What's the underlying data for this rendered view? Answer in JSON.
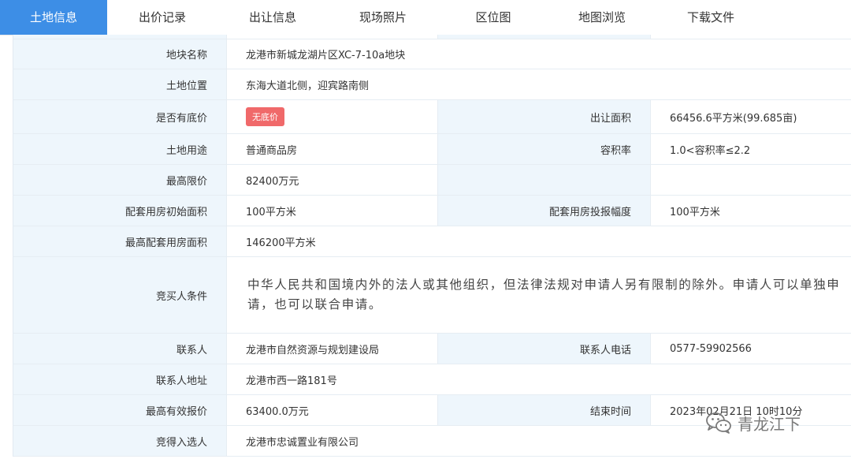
{
  "tabs": [
    "土地信息",
    "出价记录",
    "出让信息",
    "现场照片",
    "区位图",
    "地图浏览",
    "下载文件"
  ],
  "rows": {
    "name": {
      "label": "地块名称",
      "value": "龙港市新城龙湖片区XC-7-10a地块"
    },
    "location": {
      "label": "土地位置",
      "value": "东海大道北侧，迎宾路南侧"
    },
    "reserve": {
      "label": "是否有底价",
      "badge": "无底价",
      "label2": "出让面积",
      "value2": "66456.6平方米(99.685亩)"
    },
    "use": {
      "label": "土地用途",
      "value": "普通商品房",
      "label2": "容积率",
      "value2": "1.0<容积率≤2.2"
    },
    "max_price": {
      "label": "最高限价",
      "value": "82400万元"
    },
    "housing_init": {
      "label": "配套用房初始面积",
      "value": "100平方米",
      "label2": "配套用房投报幅度",
      "value2": "100平方米"
    },
    "housing_max": {
      "label": "最高配套用房面积",
      "value": "146200平方米"
    },
    "conditions": {
      "label": "竞买人条件",
      "value": "中华人民共和国境内外的法人或其他组织，但法律法规对申请人另有限制的除外。申请人可以单独申请，也可以联合申请。"
    },
    "contact": {
      "label": "联系人",
      "value": "龙港市自然资源与规划建设局",
      "label2": "联系人电话",
      "value2": "0577-59902566"
    },
    "address": {
      "label": "联系人地址",
      "value": "龙港市西一路181号"
    },
    "top_bid": {
      "label": "最高有效报价",
      "value": "63400.0万元",
      "label2": "结束时间",
      "value2": "2023年02月21日 10时10分"
    },
    "winner": {
      "label": "竞得入选人",
      "value": "龙港市忠诚置业有限公司"
    }
  },
  "watermark": {
    "icon": "wechat-icon",
    "text": "青龙江下"
  },
  "colors": {
    "accent": "#3d8ee6",
    "label_bg": "#eef6fc",
    "badge": "#f0696a"
  }
}
